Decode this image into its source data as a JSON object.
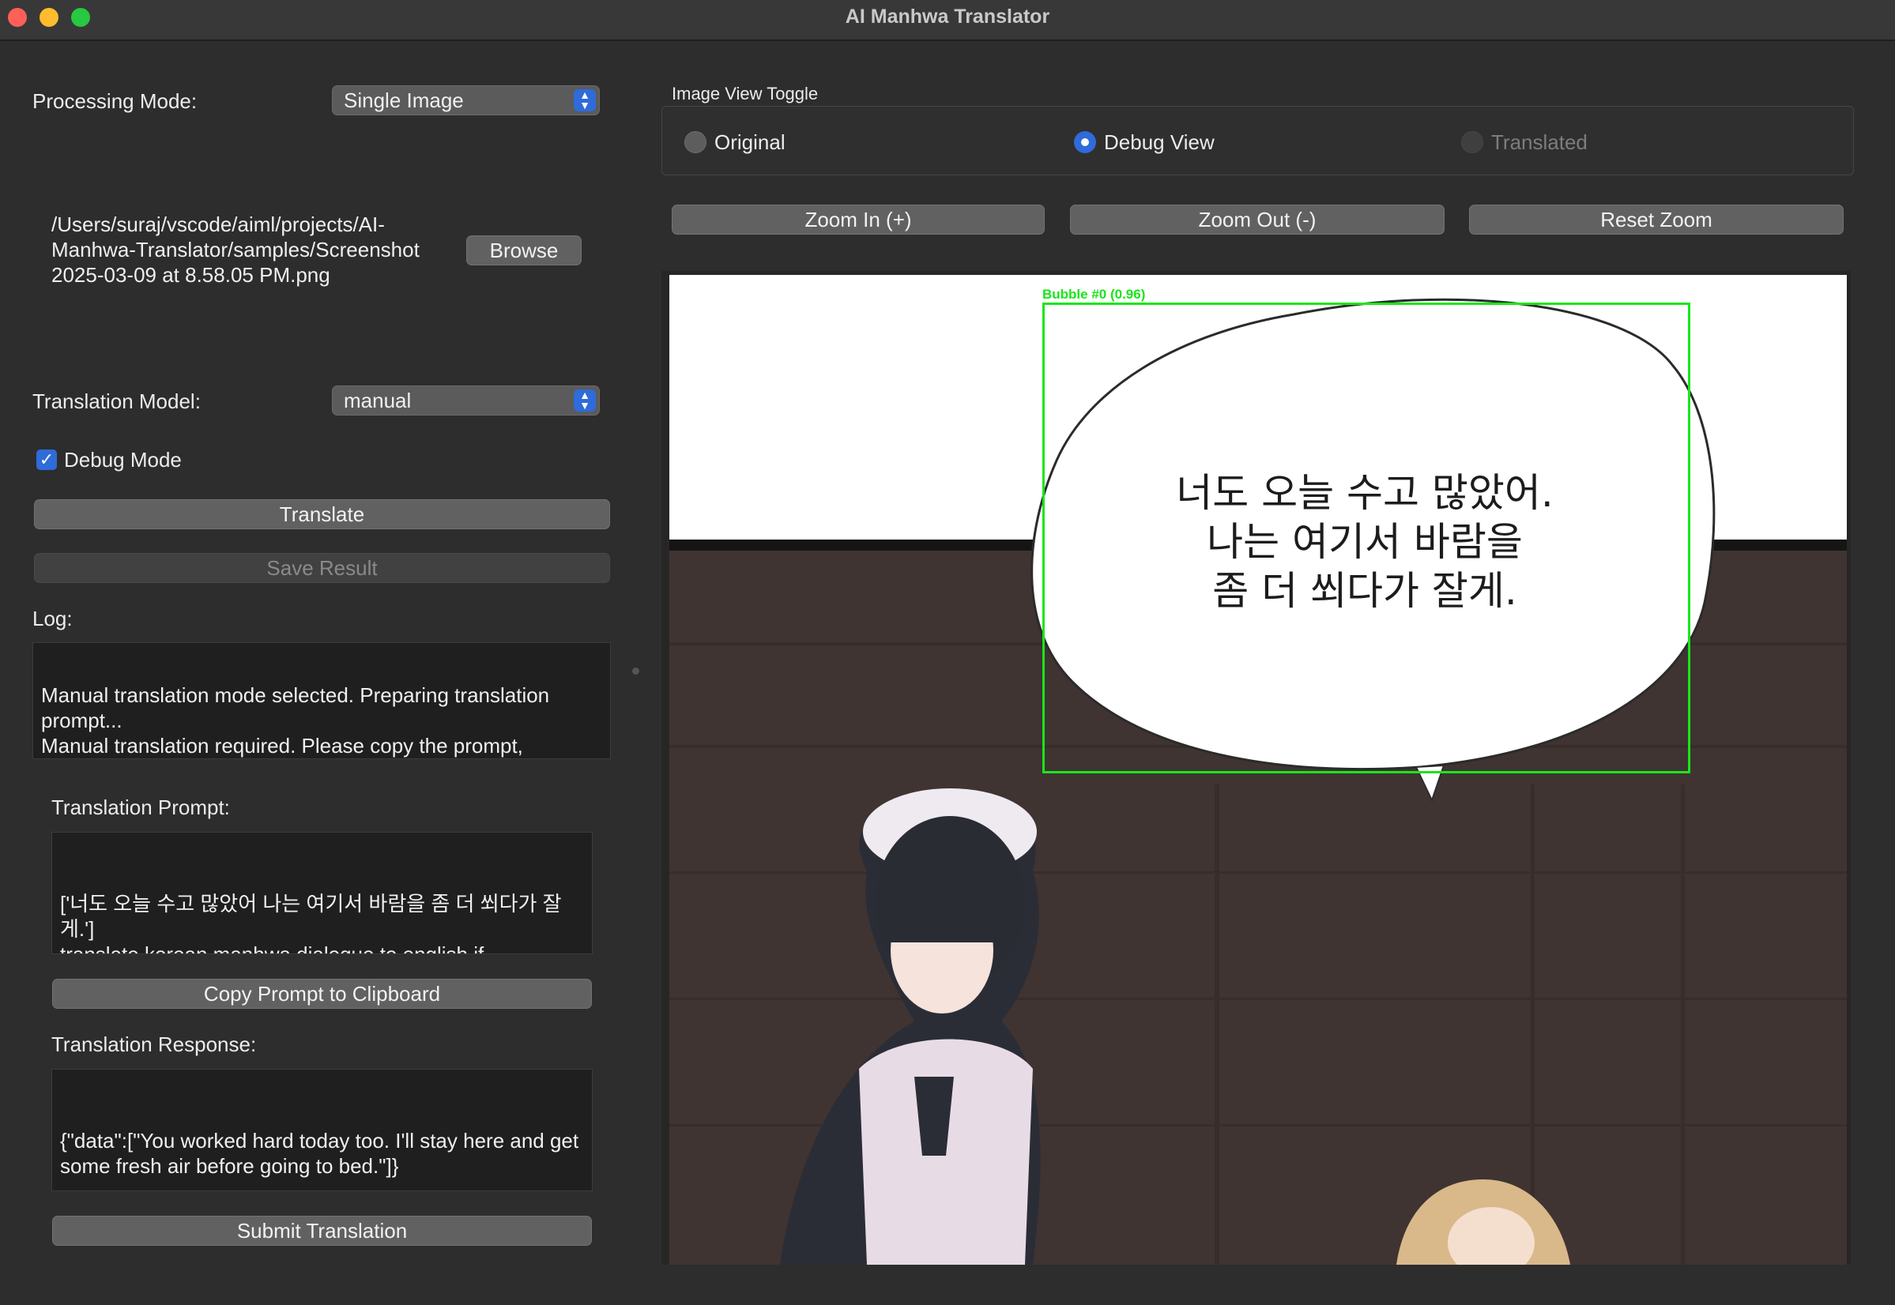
{
  "window": {
    "title": "AI Manhwa Translator"
  },
  "processing": {
    "label": "Processing Mode:",
    "value": "Single Image"
  },
  "file": {
    "path": "/Users/suraj/vscode/aiml/projects/AI-\nManhwa-Translator/samples/Screenshot\n2025-03-09 at 8.58.05 PM.png",
    "browse_label": "Browse"
  },
  "model": {
    "label": "Translation Model:",
    "value": "manual"
  },
  "debug": {
    "label": "Debug Mode",
    "checked": true
  },
  "actions": {
    "translate_label": "Translate",
    "save_label": "Save Result"
  },
  "log": {
    "label": "Log:",
    "text": "Manual translation mode selected. Preparing translation\nprompt...\nManual translation required. Please copy the prompt,\ntranslate it, and paste the result.\nPrompt copied to clipboard"
  },
  "prompt": {
    "label": "Translation Prompt:",
    "text": "['너도 오늘 수고 많았어 나는 여기서 바람을 좀 더 쐬다가 잘게.']\ntranslate korean manhwa dialogue to english.if translation not possible keep \"\" as placeholder to maintain order of list  Don't return anything else. return only list of translated text  in json format {\"data\":",
    "copy_label": "Copy Prompt to Clipboard"
  },
  "response": {
    "label": "Translation Response:",
    "text": "{\"data\":[\"You worked hard today too. I'll stay here and get some fresh air before going to bed.\"]}",
    "submit_label": "Submit Translation"
  },
  "view_toggle": {
    "label": "Image View Toggle",
    "options": [
      {
        "label": "Original",
        "selected": false,
        "enabled": true
      },
      {
        "label": "Debug View",
        "selected": true,
        "enabled": true
      },
      {
        "label": "Translated",
        "selected": false,
        "enabled": false
      }
    ]
  },
  "zoom": {
    "in_label": "Zoom In (+)",
    "out_label": "Zoom Out (-)",
    "reset_label": "Reset Zoom"
  },
  "preview": {
    "bubble_tag": "Bubble #0 (0.96)",
    "bubble_lines": [
      "너도 오늘 수고 많았어.",
      "나는 여기서 바람을",
      "좀 더 쐬다가 잘게."
    ]
  },
  "colors": {
    "accent": "#2f6bd9",
    "detection_box": "#19e619"
  }
}
